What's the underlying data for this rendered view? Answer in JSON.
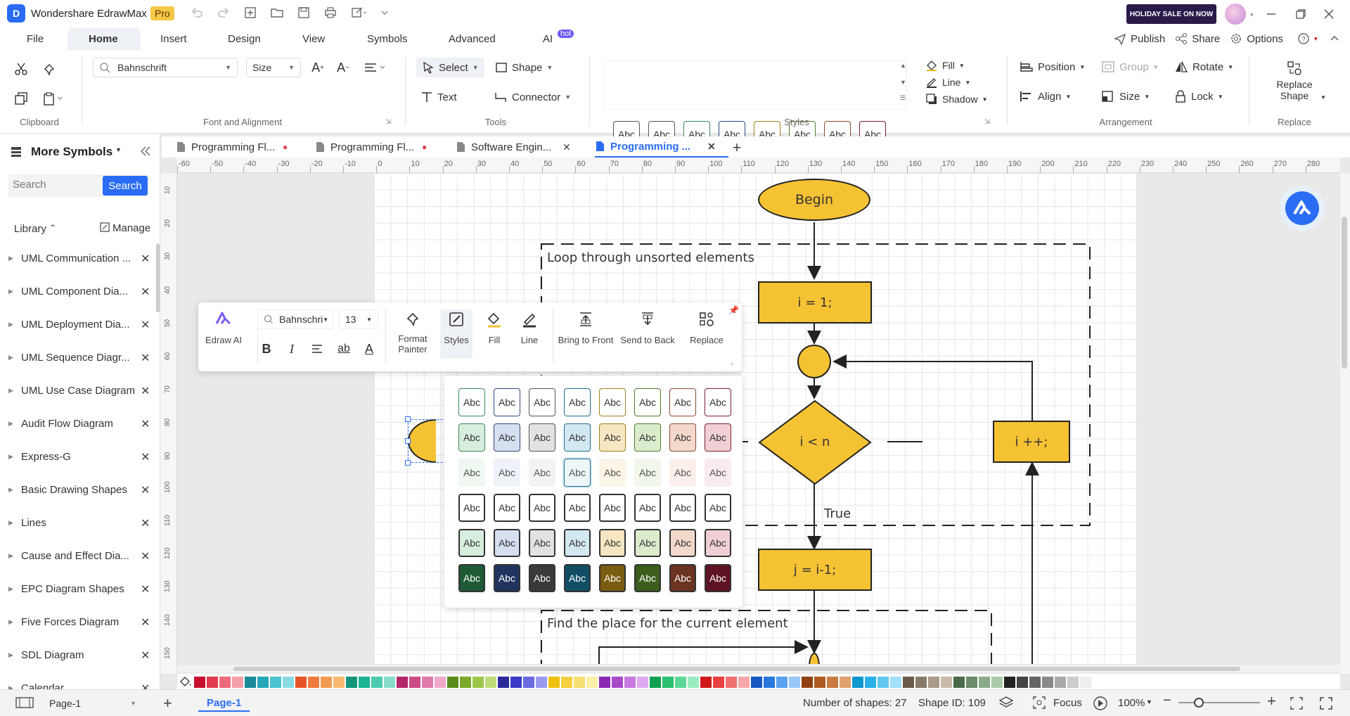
{
  "app": {
    "title": "Wondershare EdrawMax",
    "badge": "Pro",
    "sale": "HOLIDAY SALE ON NOW"
  },
  "menu": {
    "items": [
      "File",
      "Home",
      "Insert",
      "Design",
      "View",
      "Symbols",
      "Advanced",
      "AI"
    ],
    "active": "Home",
    "ai_badge": "hot",
    "publish": "Publish",
    "share": "Share",
    "options": "Options"
  },
  "ribbon": {
    "font": "Bahnschrift",
    "size": "Size",
    "select": "Select",
    "shape": "Shape",
    "text": "Text",
    "connector": "Connector",
    "style_swatch_label": "Abc",
    "fill": "Fill",
    "line": "Line",
    "shadow": "Shadow",
    "position": "Position",
    "group": "Group",
    "rotate": "Rotate",
    "align": "Align",
    "lock": "Lock",
    "replace_shape_1": "Replace",
    "replace_shape_2": "Shape",
    "groups": {
      "clipboard": "Clipboard",
      "font": "Font and Alignment",
      "tools": "Tools",
      "styles": "Styles",
      "arrangement": "Arrangement",
      "replace": "Replace"
    }
  },
  "sidebar": {
    "title": "More Symbols",
    "search_placeholder": "Search",
    "search_btn": "Search",
    "library": "Library",
    "manage": "Manage",
    "items": [
      "UML Communication ...",
      "UML Component Dia...",
      "UML Deployment Dia...",
      "UML Sequence Diagr...",
      "UML Use Case Diagram",
      "Audit Flow Diagram",
      "Express-G",
      "Basic Drawing Shapes",
      "Lines",
      "Cause and Effect Dia...",
      "EPC Diagram Shapes",
      "Five Forces Diagram",
      "SDL Diagram",
      "Calendar"
    ]
  },
  "tabs": [
    {
      "label": "Programming Fl...",
      "dirty": true
    },
    {
      "label": "Programming Fl...",
      "dirty": true
    },
    {
      "label": "Software Engin...",
      "dirty": false
    },
    {
      "label": "Programming ...",
      "dirty": false,
      "active": true
    }
  ],
  "ruler": {
    "h": [
      "-60",
      "-50",
      "-40",
      "-30",
      "-20",
      "-10",
      "0",
      "10",
      "20",
      "30",
      "40",
      "50",
      "60",
      "70",
      "80",
      "90",
      "100",
      "110",
      "120",
      "130",
      "140",
      "150",
      "160",
      "170",
      "180",
      "190",
      "200",
      "210",
      "220",
      "230",
      "240",
      "250",
      "260",
      "270",
      "280"
    ],
    "v": [
      "10",
      "20",
      "30",
      "40",
      "50",
      "60",
      "70",
      "80",
      "90",
      "100",
      "110",
      "120",
      "130",
      "140",
      "150"
    ]
  },
  "flowchart": {
    "begin": "Begin",
    "loop_label": "Loop through unsorted elements",
    "init": "i = 1;",
    "cond": "i < n",
    "incr": "i ++;",
    "true_label": "True",
    "assign": "j = i-1;",
    "find_label": "Find the place for the current element"
  },
  "floatbar": {
    "edraw_ai": "Edraw AI",
    "font": "Bahnschri",
    "size": "13",
    "format_painter_1": "Format",
    "format_painter_2": "Painter",
    "styles": "Styles",
    "fill": "Fill",
    "line": "Line",
    "bring_front": "Bring to Front",
    "send_back": "Send to Back",
    "replace": "Replace"
  },
  "style_panel": {
    "label": "Abc",
    "accents": [
      "#3a8a5a",
      "#2f4a7a",
      "#555555",
      "#1f6d8c",
      "#a0811e",
      "#4d7c2a",
      "#8a4a30",
      "#7a2030"
    ],
    "tints": [
      "#d7eddd",
      "#d6dff0",
      "#e2e2e2",
      "#d2e8f0",
      "#f6e6c2",
      "#dbeccd",
      "#f3d8cc",
      "#f0d0d4"
    ],
    "darks": [
      "#1e5a36",
      "#1f3560",
      "#3a3a3a",
      "#114e66",
      "#7a5c10",
      "#3b5e1c",
      "#6a3420",
      "#5e1322"
    ]
  },
  "palette": [
    "#c8102e",
    "#e03a4e",
    "#f06a7a",
    "#f4a0aa",
    "#1a8a9a",
    "#24a8b8",
    "#4cc4d0",
    "#8adce4",
    "#e8542a",
    "#f07a3a",
    "#f49a50",
    "#f8b870",
    "#12947a",
    "#1ab494",
    "#4ccab0",
    "#88ddca",
    "#b4286a",
    "#cc4a86",
    "#e07aaa",
    "#f0a8c8",
    "#5a8a1a",
    "#7aaa2a",
    "#9ac84a",
    "#c0dc7a",
    "#2a2a9a",
    "#3a3ac8",
    "#6a6ae0",
    "#9a9af0",
    "#f0c010",
    "#f4d040",
    "#f8e070",
    "#fcf0a8",
    "#8a2ab4",
    "#a84ac8",
    "#c87ae0",
    "#e0aaf0",
    "#10a050",
    "#2ac070",
    "#5ad898",
    "#9aecc0",
    "#d01818",
    "#e84040",
    "#f07070",
    "#f8a8a8",
    "#1858c0",
    "#2878e0",
    "#58a0f0",
    "#98c8f8",
    "#904010",
    "#b05a20",
    "#c87a40",
    "#e0a070",
    "#1098d0",
    "#28b0e8",
    "#60c8f0",
    "#a0e0f8",
    "#6a5a4a",
    "#8a7a6a",
    "#aa9a8a",
    "#cabaaa",
    "#4a6a4a",
    "#6a8a6a",
    "#8aaa8a",
    "#aacaaa",
    "#222222",
    "#444444",
    "#666666",
    "#888888",
    "#aaaaaa",
    "#cccccc",
    "#eeeeee"
  ],
  "status": {
    "page_select": "Page-1",
    "page_tab": "Page-1",
    "shapes": "Number of shapes: 27",
    "shape_id": "Shape ID: 109",
    "focus": "Focus",
    "zoom": "100%",
    "zoom_level": 0.5
  }
}
